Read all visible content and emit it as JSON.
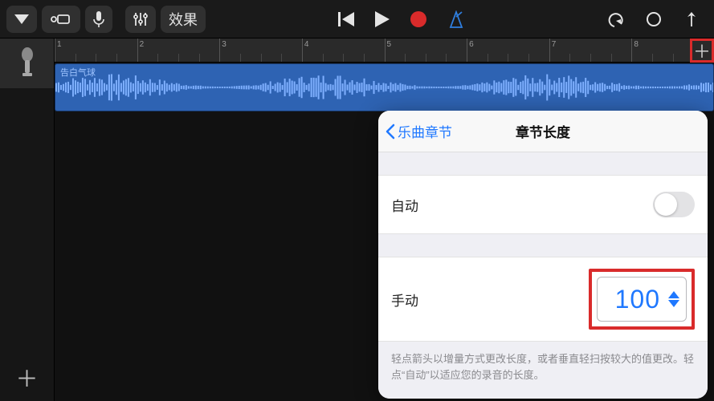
{
  "toolbar": {
    "fx_label": "效果"
  },
  "ruler": {
    "bars": [
      "1",
      "2",
      "3",
      "4",
      "5",
      "6",
      "7",
      "8"
    ]
  },
  "track": {
    "region_name": "告白气球"
  },
  "popover": {
    "back_label": "乐曲章节",
    "title": "章节长度",
    "auto_label": "自动",
    "auto_value": false,
    "manual_label": "手动",
    "manual_value": "100",
    "hint": "轻点箭头以增量方式更改长度，或者垂直轻扫按较大的值更改。轻点“自动”以适应您的录音的长度。"
  }
}
